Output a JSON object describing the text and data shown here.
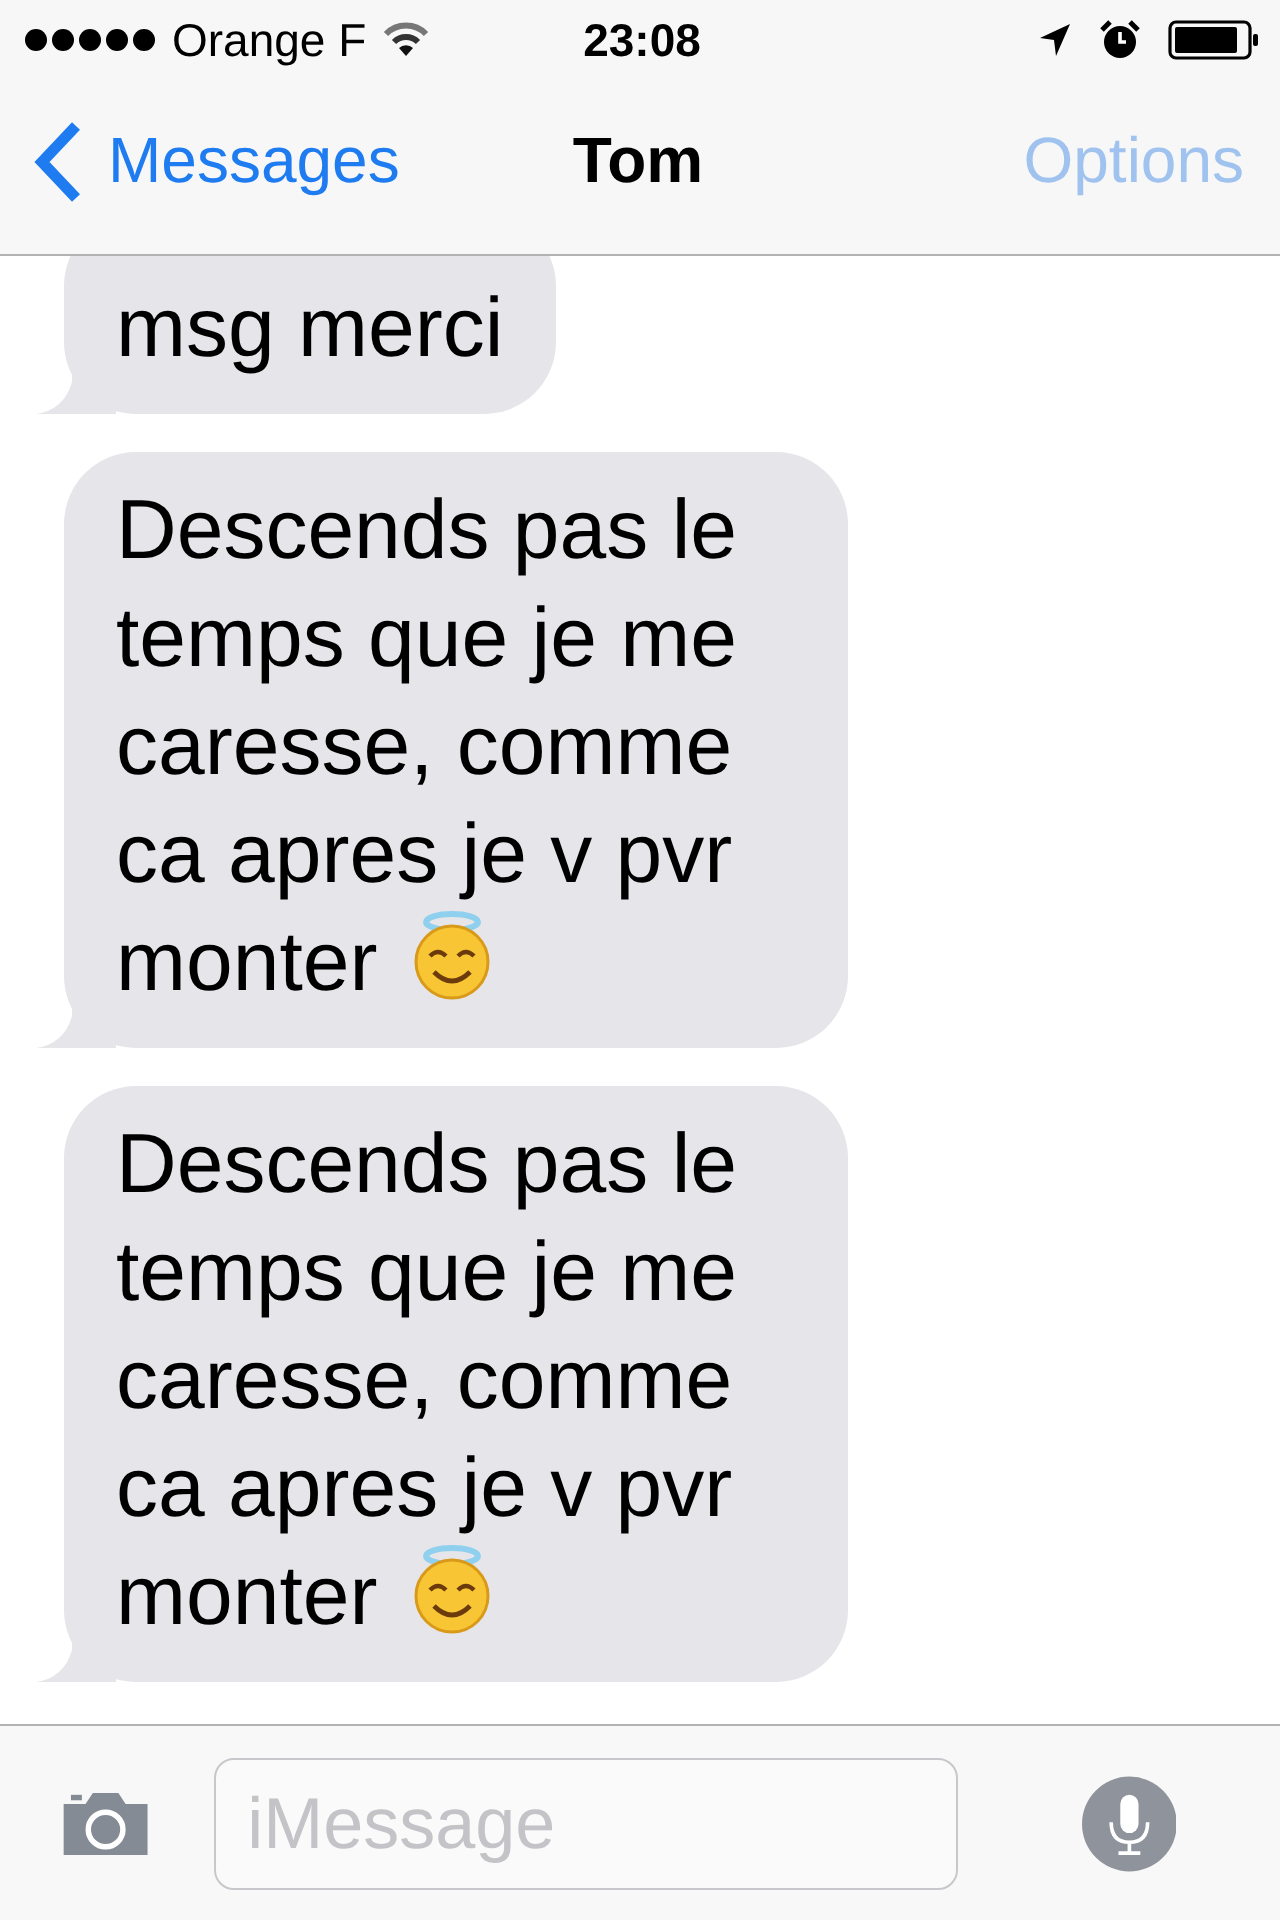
{
  "status_bar": {
    "carrier": "Orange F",
    "time": "23:08"
  },
  "nav_bar": {
    "back_label": "Messages",
    "title": "Tom",
    "action": {
      "label": "Options",
      "disabled": true
    }
  },
  "messages": [
    {
      "text": "msg merci",
      "emoji": false
    },
    {
      "text": "Descends pas le temps que je me caresse, comme ca apres je v pvr monter",
      "emoji": true
    },
    {
      "text": "Descends pas le temps que je me caresse, comme ca apres je v pvr monter",
      "emoji": true
    }
  ],
  "composer": {
    "placeholder": "iMessage"
  }
}
